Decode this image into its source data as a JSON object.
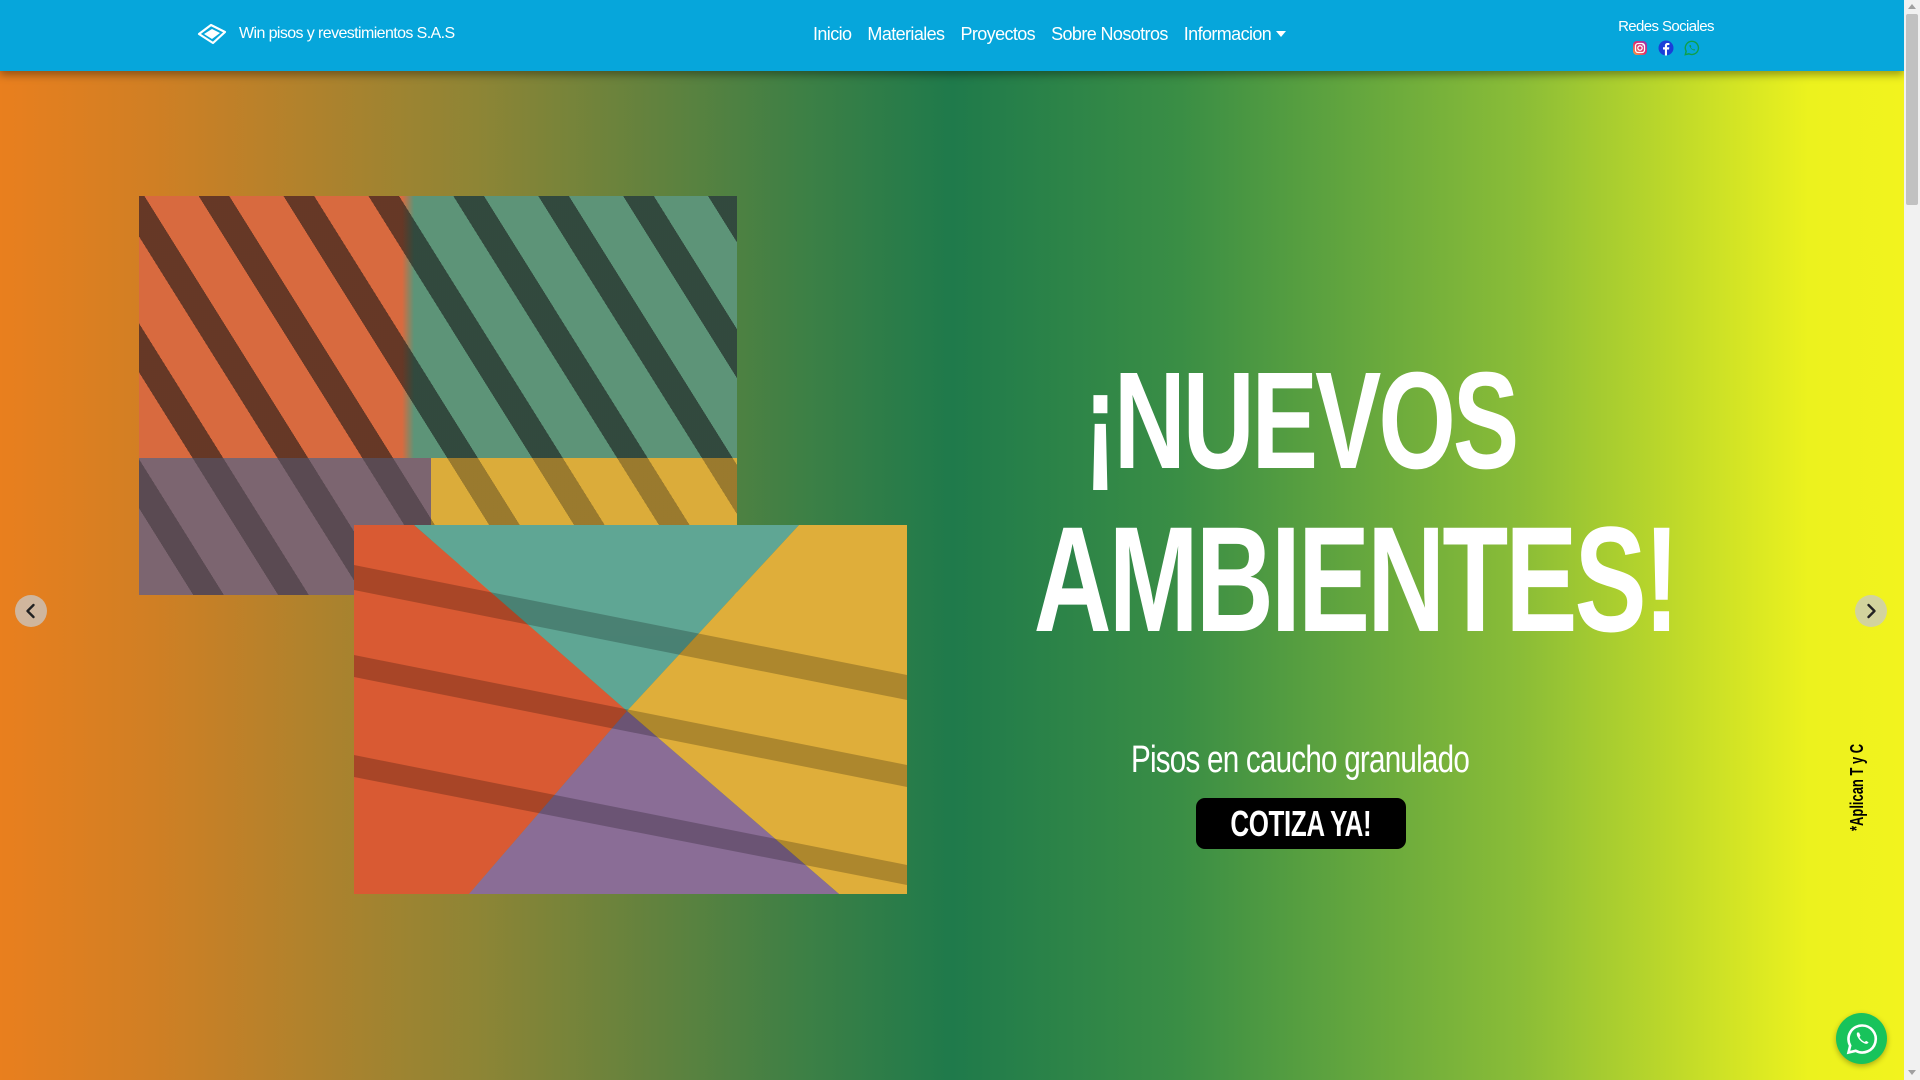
{
  "navbar": {
    "brand": {
      "name": "Win pisos y revestimientos S.A.S",
      "icon": "diamond-logo-icon"
    },
    "links": [
      {
        "label": "Inicio"
      },
      {
        "label": "Materiales"
      },
      {
        "label": "Proyectos"
      },
      {
        "label": "Sobre Nosotros"
      },
      {
        "label": "Informacion",
        "dropdown": true
      }
    ],
    "social": {
      "title": "Redes Sociales",
      "icons": [
        "instagram-icon",
        "facebook-icon",
        "whatsapp-icon"
      ]
    }
  },
  "hero": {
    "title_line1": "¡NUEVOS",
    "title_line2": "AMBIENTES!",
    "subtitle": "Pisos en caucho granulado",
    "cta_label": "COTIZA YA!",
    "terms": "*Aplican T y C",
    "controls": {
      "prev": "chevron-left-icon",
      "next": "chevron-right-icon"
    }
  },
  "floating": {
    "whatsapp": "whatsapp-float-icon"
  },
  "colors": {
    "navbar_bg": "#06a6db",
    "hero_gradient": [
      "#e97f1e",
      "#1f7a4b",
      "#f2f31e"
    ],
    "cta_bg": "#000000",
    "whatsapp_green": "#18c35b"
  }
}
